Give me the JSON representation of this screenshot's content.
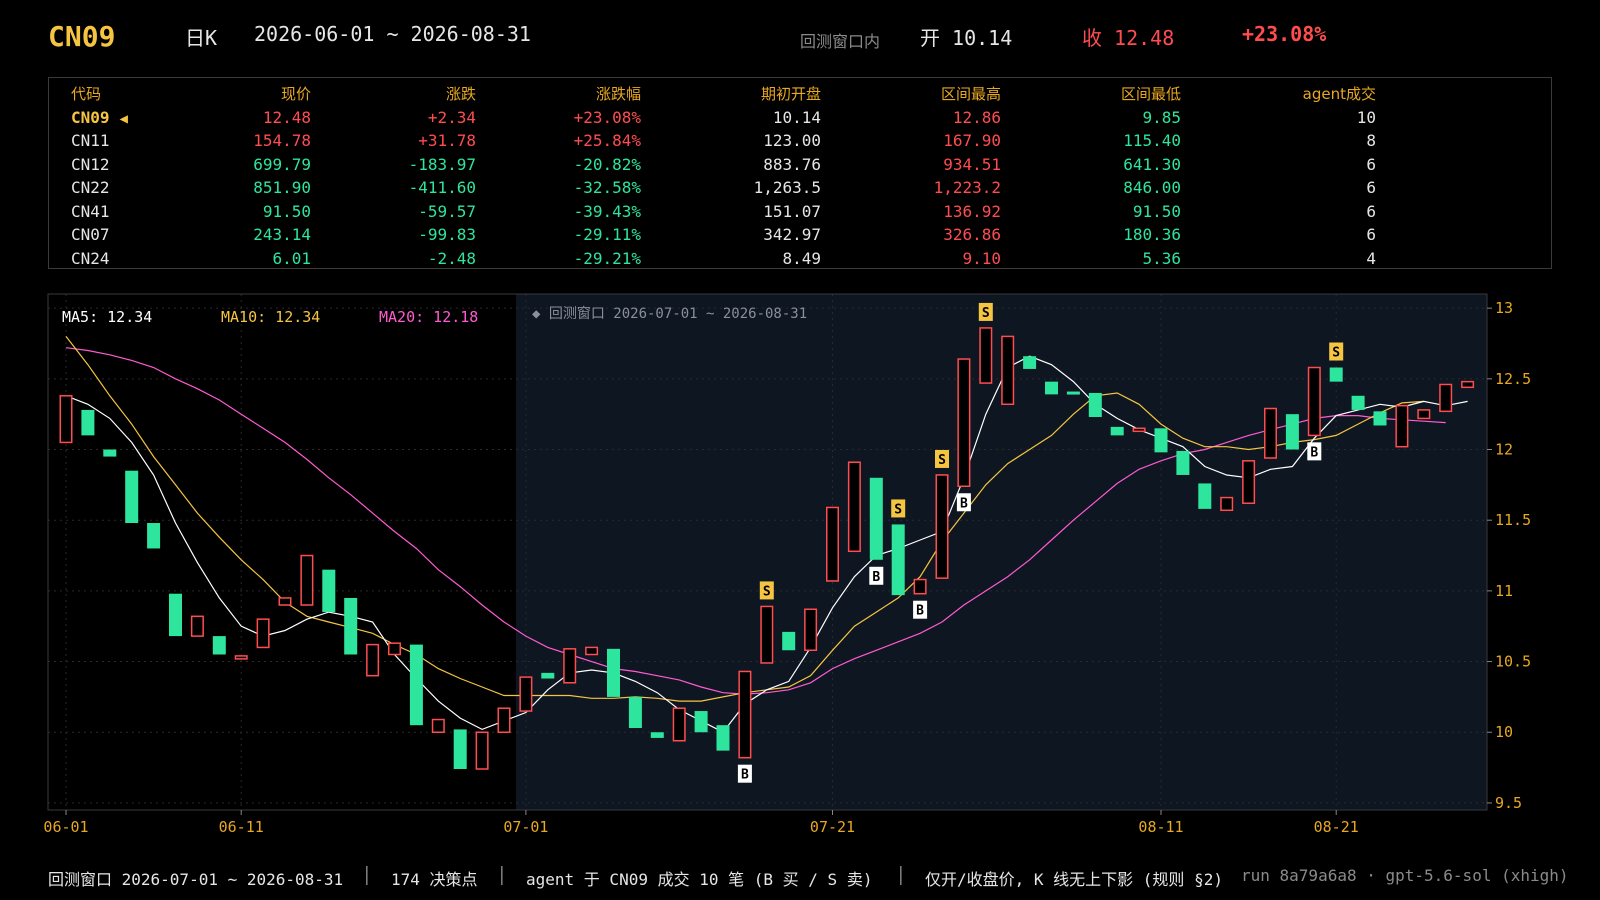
{
  "header": {
    "symbol": "CN09",
    "period": "日K",
    "range": "2026-06-01 ~ 2026-08-31",
    "window_label": "回测窗口内",
    "open_text": "开 10.14",
    "close_text": "收 12.48",
    "change_text": "+23.08%"
  },
  "table": {
    "headers": [
      "代码",
      "现价",
      "涨跌",
      "涨跌幅",
      "期初开盘",
      "区间最高",
      "区间最低",
      "agent成交"
    ],
    "selected_marker": "◀",
    "rows": [
      {
        "code": "CN09",
        "price": "12.48",
        "chg": "+2.34",
        "pct": "+23.08%",
        "open": "10.14",
        "high": "12.86",
        "low": "9.85",
        "trades": "10",
        "dir": "up",
        "selected": true
      },
      {
        "code": "CN11",
        "price": "154.78",
        "chg": "+31.78",
        "pct": "+25.84%",
        "open": "123.00",
        "high": "167.90",
        "low": "115.40",
        "trades": "8",
        "dir": "up",
        "selected": false
      },
      {
        "code": "CN12",
        "price": "699.79",
        "chg": "-183.97",
        "pct": "-20.82%",
        "open": "883.76",
        "high": "934.51",
        "low": "641.30",
        "trades": "6",
        "dir": "dn",
        "selected": false
      },
      {
        "code": "CN22",
        "price": "851.90",
        "chg": "-411.60",
        "pct": "-32.58%",
        "open": "1,263.5",
        "high": "1,223.2",
        "low": "846.00",
        "trades": "6",
        "dir": "dn",
        "selected": false
      },
      {
        "code": "CN41",
        "price": "91.50",
        "chg": "-59.57",
        "pct": "-39.43%",
        "open": "151.07",
        "high": "136.92",
        "low": "91.50",
        "trades": "6",
        "dir": "dn",
        "selected": false
      },
      {
        "code": "CN07",
        "price": "243.14",
        "chg": "-99.83",
        "pct": "-29.11%",
        "open": "342.97",
        "high": "326.86",
        "low": "180.36",
        "trades": "6",
        "dir": "dn",
        "selected": false
      },
      {
        "code": "CN24",
        "price": "6.01",
        "chg": "-2.48",
        "pct": "-29.21%",
        "open": "8.49",
        "high": "9.10",
        "low": "5.36",
        "trades": "4",
        "dir": "dn",
        "selected": false
      }
    ]
  },
  "chart_data": {
    "type": "candlestick",
    "title": "",
    "ma_labels": {
      "ma5": "MA5: 12.34",
      "ma10": "MA10: 12.34",
      "ma20": "MA20: 12.18"
    },
    "backtest_window": {
      "label": "◆ 回测窗口 2026-07-01 ~ 2026-08-31",
      "start": "2026-07-01",
      "end": "2026-08-31"
    },
    "ylim": [
      9.45,
      13.1
    ],
    "y_ticks": [
      9.5,
      10.0,
      10.5,
      11.0,
      11.5,
      12.0,
      12.5,
      13.0
    ],
    "x_tick_labels": [
      {
        "label": "06-01",
        "index": 0
      },
      {
        "label": "06-11",
        "index": 8
      },
      {
        "label": "07-01",
        "index": 21
      },
      {
        "label": "07-21",
        "index": 35
      },
      {
        "label": "08-11",
        "index": 50
      },
      {
        "label": "08-21",
        "index": 58
      }
    ],
    "colors": {
      "up": "#ff4d4f",
      "down": "#2ee59d",
      "ma5": "#ffffff",
      "ma10": "#f5c542",
      "ma20": "#ff5bd0",
      "window_bg": "#0e1622"
    },
    "candles": [
      [
        12.05,
        12.38
      ],
      [
        12.28,
        12.1
      ],
      [
        12.0,
        11.95
      ],
      [
        11.85,
        11.48
      ],
      [
        11.48,
        11.3
      ],
      [
        10.98,
        10.68
      ],
      [
        10.68,
        10.82
      ],
      [
        10.68,
        10.55
      ],
      [
        10.52,
        10.54
      ],
      [
        10.6,
        10.8
      ],
      [
        10.9,
        10.95
      ],
      [
        10.9,
        11.25
      ],
      [
        11.15,
        10.85
      ],
      [
        10.95,
        10.55
      ],
      [
        10.4,
        10.62
      ],
      [
        10.55,
        10.63
      ],
      [
        10.62,
        10.05
      ],
      [
        10.0,
        10.09
      ],
      [
        10.02,
        9.74
      ],
      [
        9.74,
        10.0
      ],
      [
        10.0,
        10.17
      ],
      [
        10.15,
        10.39
      ],
      [
        10.42,
        10.38
      ],
      [
        10.35,
        10.59
      ],
      [
        10.55,
        10.6
      ],
      [
        10.59,
        10.25
      ],
      [
        10.25,
        10.03
      ],
      [
        10.0,
        9.96
      ],
      [
        9.94,
        10.17
      ],
      [
        10.15,
        10.0
      ],
      [
        10.05,
        9.87
      ],
      [
        9.82,
        10.43
      ],
      [
        10.49,
        10.89
      ],
      [
        10.71,
        10.58
      ],
      [
        10.58,
        10.87
      ],
      [
        11.07,
        11.59
      ],
      [
        11.28,
        11.91
      ],
      [
        11.8,
        11.22
      ],
      [
        11.47,
        10.97
      ],
      [
        10.98,
        11.08
      ],
      [
        11.09,
        11.82
      ],
      [
        11.74,
        12.64
      ],
      [
        12.47,
        12.86
      ],
      [
        12.32,
        12.8
      ],
      [
        12.66,
        12.57
      ],
      [
        12.48,
        12.39
      ],
      [
        12.41,
        12.4
      ],
      [
        12.4,
        12.23
      ],
      [
        12.16,
        12.1
      ],
      [
        12.14,
        12.15
      ],
      [
        12.15,
        11.98
      ],
      [
        11.99,
        11.82
      ],
      [
        11.76,
        11.58
      ],
      [
        11.57,
        11.66
      ],
      [
        11.62,
        11.92
      ],
      [
        11.94,
        12.29
      ],
      [
        12.25,
        12.0
      ],
      [
        12.1,
        12.58
      ],
      [
        12.58,
        12.48
      ],
      [
        12.38,
        12.28
      ],
      [
        12.27,
        12.17
      ],
      [
        12.02,
        12.31
      ],
      [
        12.22,
        12.28
      ],
      [
        12.27,
        12.46
      ],
      [
        12.44,
        12.48
      ]
    ],
    "ma5": [
      12.38,
      12.32,
      12.22,
      12.05,
      11.82,
      11.48,
      11.2,
      10.95,
      10.75,
      10.68,
      10.72,
      10.8,
      10.85,
      10.82,
      10.78,
      10.55,
      10.38,
      10.22,
      10.1,
      10.02,
      10.08,
      10.14,
      10.3,
      10.42,
      10.44,
      10.42,
      10.36,
      10.28,
      10.16,
      10.08,
      10.0,
      10.2,
      10.3,
      10.36,
      10.6,
      10.88,
      11.1,
      11.25,
      11.3,
      11.36,
      11.42,
      11.8,
      12.25,
      12.58,
      12.66,
      12.6,
      12.48,
      12.32,
      12.22,
      12.14,
      12.08,
      12.02,
      11.88,
      11.82,
      11.8,
      11.86,
      11.88,
      12.08,
      12.24,
      12.28,
      12.32,
      12.3,
      12.34,
      12.31,
      12.34
    ],
    "ma10": [
      12.8,
      12.6,
      12.38,
      12.18,
      11.95,
      11.75,
      11.55,
      11.38,
      11.22,
      11.08,
      10.92,
      10.82,
      10.78,
      10.74,
      10.7,
      10.62,
      10.55,
      10.45,
      10.38,
      10.32,
      10.26,
      10.26,
      10.26,
      10.26,
      10.24,
      10.24,
      10.25,
      10.24,
      10.22,
      10.22,
      10.25,
      10.28,
      10.3,
      10.32,
      10.4,
      10.58,
      10.75,
      10.85,
      10.95,
      11.1,
      11.35,
      11.55,
      11.75,
      11.9,
      12.0,
      12.1,
      12.25,
      12.38,
      12.4,
      12.32,
      12.18,
      12.08,
      12.02,
      12.02,
      12.0,
      12.02,
      12.05,
      12.07,
      12.1,
      12.18,
      12.26,
      12.33,
      12.34
    ],
    "ma20": [
      12.72,
      12.7,
      12.67,
      12.63,
      12.58,
      12.5,
      12.43,
      12.35,
      12.25,
      12.15,
      12.05,
      11.93,
      11.8,
      11.68,
      11.55,
      11.42,
      11.3,
      11.15,
      11.03,
      10.9,
      10.78,
      10.68,
      10.6,
      10.55,
      10.5,
      10.45,
      10.43,
      10.4,
      10.37,
      10.32,
      10.28,
      10.27,
      10.28,
      10.3,
      10.35,
      10.45,
      10.52,
      10.58,
      10.64,
      10.7,
      10.78,
      10.9,
      11.0,
      11.1,
      11.22,
      11.36,
      11.5,
      11.63,
      11.76,
      11.86,
      11.92,
      11.97,
      12.0,
      12.05,
      12.1,
      12.14,
      12.18,
      12.22,
      12.24,
      12.24,
      12.22,
      12.21,
      12.2,
      12.19
    ],
    "markers": [
      {
        "index": 31,
        "type": "B"
      },
      {
        "index": 32,
        "type": "S"
      },
      {
        "index": 37,
        "type": "B"
      },
      {
        "index": 38,
        "type": "S"
      },
      {
        "index": 39,
        "type": "B"
      },
      {
        "index": 40,
        "type": "S"
      },
      {
        "index": 41,
        "type": "B"
      },
      {
        "index": 42,
        "type": "S"
      },
      {
        "index": 57,
        "type": "B"
      },
      {
        "index": 58,
        "type": "S"
      }
    ]
  },
  "footer": {
    "window": "回测窗口 2026-07-01 ~ 2026-08-31",
    "sep": "│",
    "decisions": "174 决策点",
    "trades": "agent 于 CN09 成交 10 笔 (B 买 / S 卖)",
    "rule": "仅开/收盘价, K 线无上下影 (规则 §2)",
    "run": "run 8a79a6a8 · gpt-5.6-sol (xhigh)"
  }
}
